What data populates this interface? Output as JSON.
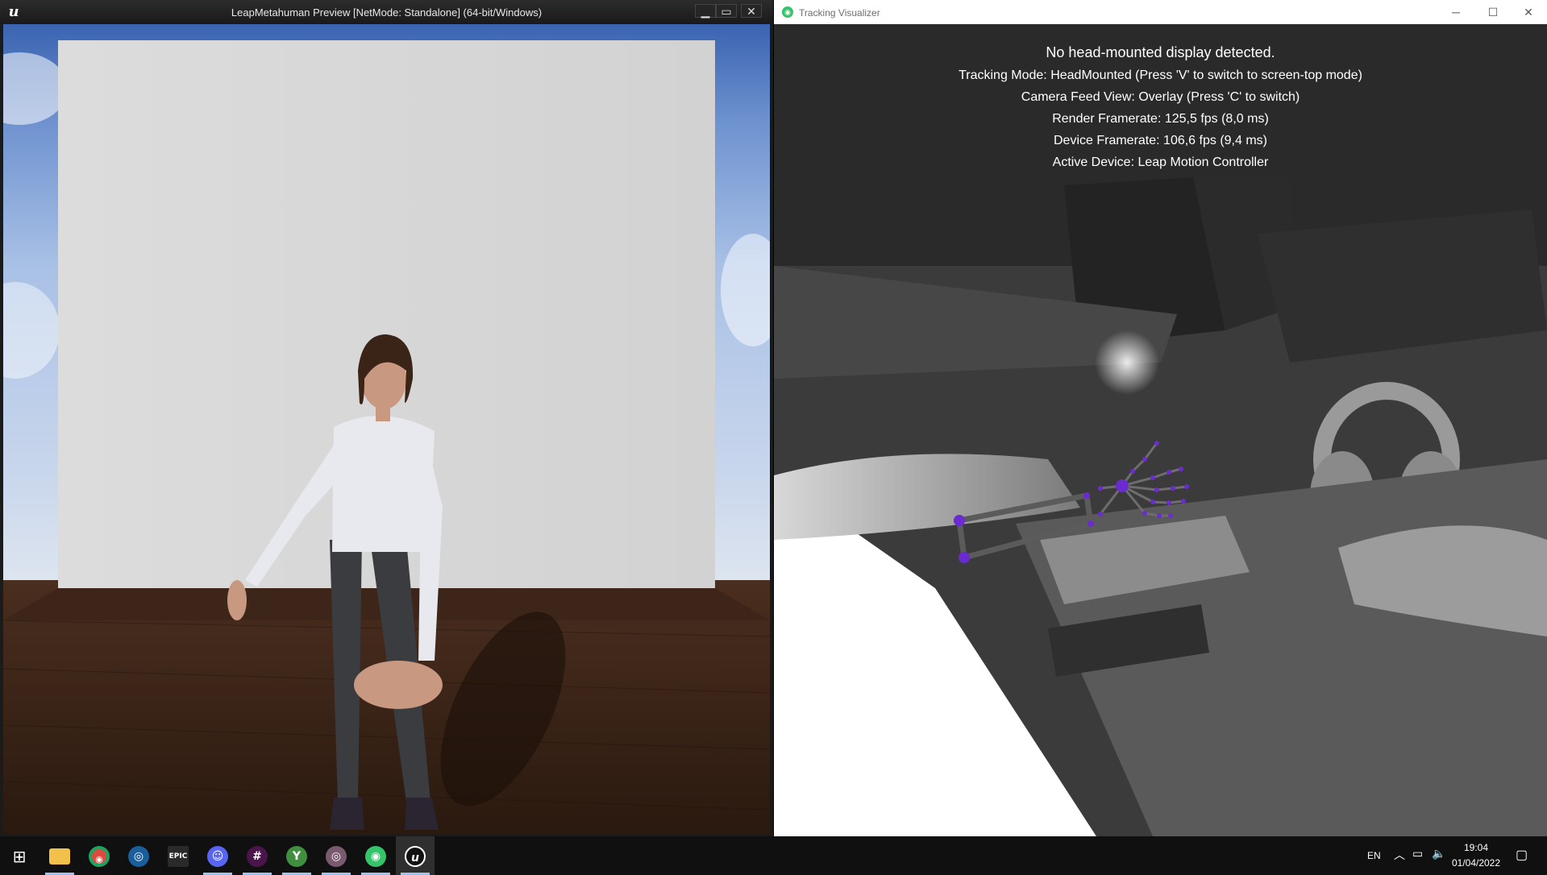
{
  "ue_window": {
    "title": "LeapMetahuman Preview [NetMode: Standalone]  (64-bit/Windows)",
    "logo_glyph": "u",
    "controls": {
      "minimize": "▁",
      "restore": "▭",
      "close": "✕"
    }
  },
  "tracking_visualizer": {
    "title": "Tracking Visualizer",
    "controls": {
      "minimize": "─",
      "maximize": "☐",
      "close": "✕"
    },
    "info_lines": [
      "No head-mounted display detected.",
      "Tracking Mode: HeadMounted (Press 'V' to switch to screen-top mode)",
      "Camera Feed View: Overlay (Press 'C' to switch)",
      "Render Framerate: 125,5 fps (8,0 ms)",
      "Device Framerate: 106,6 fps (9,4 ms)",
      "Active Device: Leap Motion Controller"
    ],
    "hand_joint_color": "#6a2bd0"
  },
  "taskbar": {
    "apps": [
      {
        "name": "start",
        "glyph": "⊞"
      },
      {
        "name": "file-explorer",
        "glyph": "▬"
      },
      {
        "name": "chrome",
        "glyph": "◉"
      },
      {
        "name": "steam",
        "glyph": "◎"
      },
      {
        "name": "epic-games",
        "glyph": "EPIC"
      },
      {
        "name": "discord",
        "glyph": "☺"
      },
      {
        "name": "slack",
        "glyph": "#"
      },
      {
        "name": "app-y",
        "glyph": "Y"
      },
      {
        "name": "app-disc",
        "glyph": "◎"
      },
      {
        "name": "app-eye",
        "glyph": "◉"
      },
      {
        "name": "unreal",
        "glyph": "u"
      }
    ],
    "language": "EN",
    "time": "19:04",
    "date": "01/04/2022"
  }
}
